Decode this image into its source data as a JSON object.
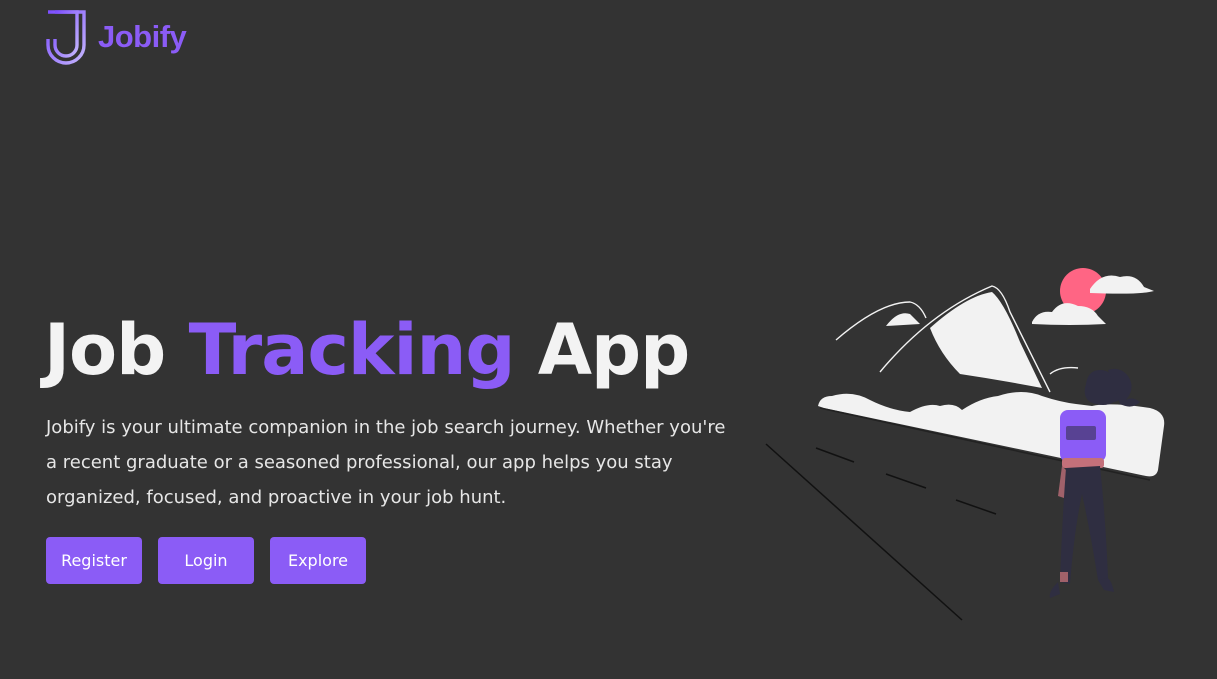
{
  "brand": {
    "logo_icon": "j-logo-icon",
    "name": "Jobify",
    "accent_color": "#8b5cf6"
  },
  "hero": {
    "title_part1": "Job",
    "title_accent": "Tracking",
    "title_part2": "App",
    "description": "Jobify is your ultimate companion in the job search journey. Whether you're a recent graduate or a seasoned professional, our app helps you stay organized, focused, and proactive in your job hunt."
  },
  "buttons": {
    "register": "Register",
    "login": "Login",
    "explore": "Explore"
  },
  "illustration": {
    "icon": "hiker-mountains-illustration",
    "sun_color": "#ff6584",
    "shirt_color": "#8b5cf6"
  },
  "colors": {
    "background": "#333333",
    "text": "#f3f3f3",
    "accent": "#8b5cf6"
  }
}
